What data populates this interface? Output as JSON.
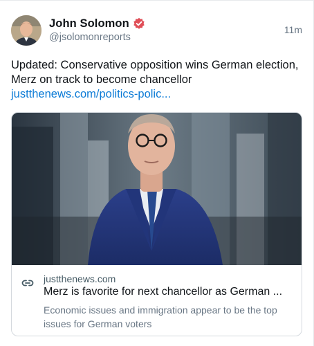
{
  "author": {
    "name": "John Solomon",
    "handle": "@jsolomonreports",
    "verified_color": "#e04e57"
  },
  "timestamp": "11m",
  "post": {
    "text": "Updated: Conservative opposition wins German election, Merz on track to become chancellor",
    "link_text": "justthenews.com/politics-polic..."
  },
  "link_card": {
    "domain": "justthenews.com",
    "headline": "Merz is favorite for next chancellor as German ...",
    "description": "Economic issues and immigration appear to be the top issues for German voters",
    "icon": "link-icon"
  },
  "colors": {
    "link": "#0c7bd6",
    "secondary_text": "#687684"
  }
}
